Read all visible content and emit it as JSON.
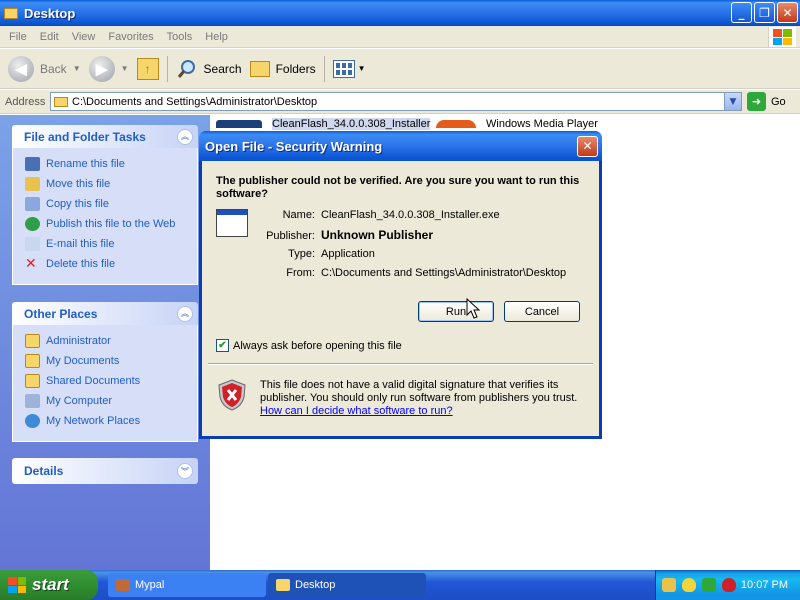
{
  "window": {
    "title": "Desktop"
  },
  "menu": [
    "File",
    "Edit",
    "View",
    "Favorites",
    "Tools",
    "Help"
  ],
  "toolbar": {
    "back": "Back",
    "search": "Search",
    "folders": "Folders"
  },
  "address": {
    "label": "Address",
    "value": "C:\\Documents and Settings\\Administrator\\Desktop",
    "go": "Go"
  },
  "tasks": {
    "title": "File and Folder Tasks",
    "items": [
      "Rename this file",
      "Move this file",
      "Copy this file",
      "Publish this file to the Web",
      "E-mail this file",
      "Delete this file"
    ]
  },
  "other_places": {
    "title": "Other Places",
    "items": [
      "Administrator",
      "My Documents",
      "Shared Documents",
      "My Computer",
      "My Network Places"
    ]
  },
  "details": {
    "title": "Details"
  },
  "files": [
    "CleanFlash_34.0.0.308_Installer",
    "Windows Media Player"
  ],
  "dialog": {
    "title": "Open File - Security Warning",
    "question": "The publisher could not be verified.  Are you sure you want to run this software?",
    "fields": [
      {
        "key": "Name:",
        "value": "CleanFlash_34.0.0.308_Installer.exe"
      },
      {
        "key": "Publisher:",
        "value": "Unknown Publisher"
      },
      {
        "key": "Type:",
        "value": "Application"
      },
      {
        "key": "From:",
        "value": "C:\\Documents and Settings\\Administrator\\Desktop"
      }
    ],
    "run_button": "Run",
    "cancel_button": "Cancel",
    "checkbox_label": "Always ask before opening this file",
    "checkbox_checked": true,
    "warning_text": "This file does not have a valid digital signature that verifies its publisher.  You should only run software from publishers you trust.",
    "warning_link": "How can I decide what software to run?"
  },
  "taskbar": {
    "start": "start",
    "tasks": [
      "Mypal",
      "Desktop"
    ],
    "clock": "10:07 PM"
  },
  "colors": {
    "xp_blue": "#0a5fd8",
    "taskpane_link": "#215dc6",
    "start_green": "#3c9b3c",
    "close_red": "#c3391a"
  }
}
